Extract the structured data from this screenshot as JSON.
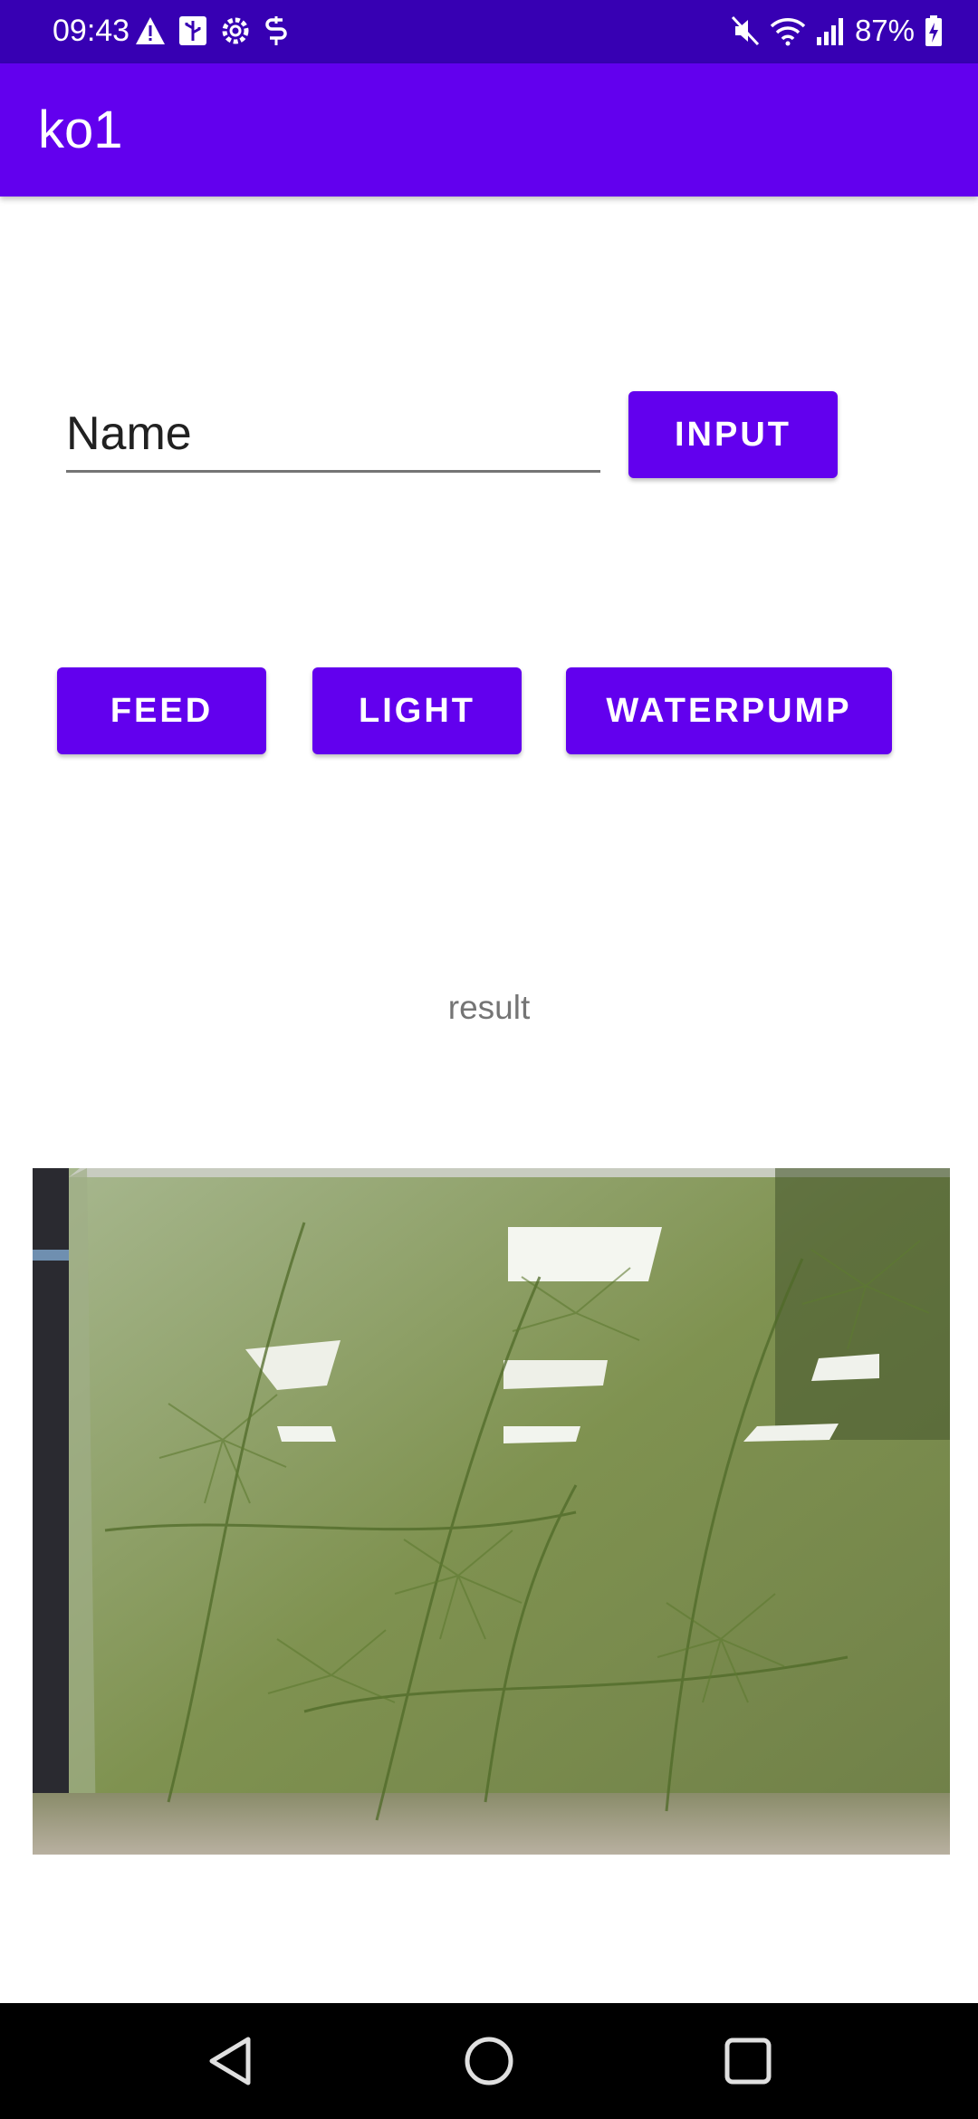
{
  "status_bar": {
    "time": "09:43",
    "battery_text": "87%",
    "left_icons": [
      "warning-icon",
      "usb-icon",
      "settings-icon",
      "app-notification-icon"
    ],
    "right_icons": [
      "mute-icon",
      "wifi-icon",
      "signal-icon",
      "battery-charging-icon"
    ]
  },
  "app_bar": {
    "title": "ko1"
  },
  "form": {
    "name_placeholder": "Name",
    "input_button": "INPUT"
  },
  "controls": {
    "feed": "FEED",
    "light": "LIGHT",
    "waterpump": "WATERPUMP"
  },
  "result": {
    "text": "result"
  },
  "camera": {
    "description_icon": "aquarium-camera-feed"
  },
  "nav_bar": {
    "icons": [
      "back-icon",
      "home-icon",
      "recents-icon"
    ]
  },
  "colors": {
    "status_bar": "#3700b3",
    "primary": "#6200ee",
    "nav_bar": "#000000"
  }
}
